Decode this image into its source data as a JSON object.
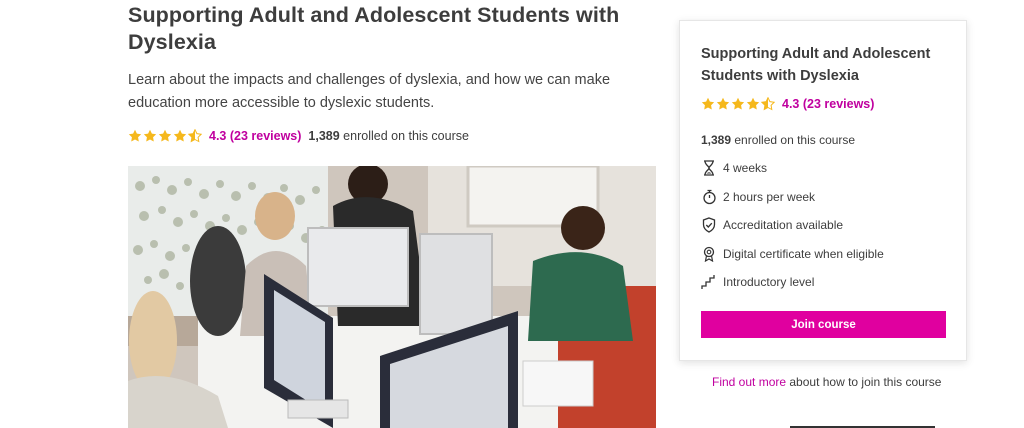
{
  "course": {
    "title": "Supporting Adult and Adolescent Students with Dyslexia",
    "description": "Learn about the impacts and challenges of dyslexia, and how we can make education more accessible to dyslexic students.",
    "rating_text": "4.3 (23 reviews)",
    "rating_value": 4.3,
    "rating_max": 5,
    "enrolled_count": "1,389",
    "enrolled_suffix": " enrolled on this course"
  },
  "card": {
    "title": "Supporting Adult and Adolescent Students with Dyslexia",
    "rating_text": "4.3 (23 reviews)",
    "enrolled_count": "1,389",
    "enrolled_suffix": " enrolled on this course",
    "features": [
      {
        "icon": "hourglass-icon",
        "label": "4 weeks"
      },
      {
        "icon": "stopwatch-icon",
        "label": "2 hours per week"
      },
      {
        "icon": "shield-check-icon",
        "label": "Accreditation available"
      },
      {
        "icon": "certificate-badge-icon",
        "label": "Digital certificate when eligible"
      },
      {
        "icon": "stairs-icon",
        "label": "Introductory level"
      }
    ],
    "join_label": "Join course"
  },
  "find_more": {
    "link": "Find out more",
    "rest": " about how to join this course"
  },
  "colors": {
    "accent": "#e0009f",
    "link": "#c0009f",
    "star": "#f5b81c"
  }
}
